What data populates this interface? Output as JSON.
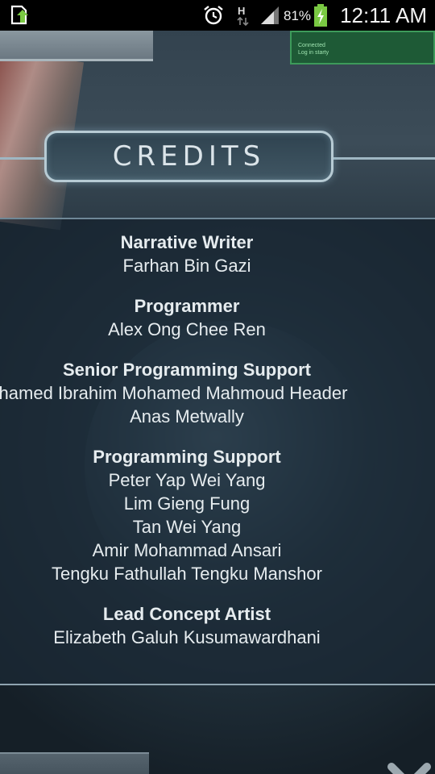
{
  "status_bar": {
    "time": "12:11 AM",
    "battery_percent": "81%",
    "network_type": "H",
    "icons": [
      "upload-notification-icon",
      "alarm-icon",
      "network-h-icon",
      "signal-icon",
      "battery-charging-icon"
    ]
  },
  "background": {
    "top_right_panel_lines": [
      "Connected",
      "Log in starty"
    ]
  },
  "credits": {
    "title": "CREDITS",
    "sections": [
      {
        "role": "Narrative Writer",
        "names": [
          "Farhan Bin Gazi"
        ]
      },
      {
        "role": "Programmer",
        "names": [
          "Alex Ong Chee Ren"
        ]
      },
      {
        "role": "Senior Programming Support",
        "names": [
          "hamed Ibrahim Mohamed Mahmoud Header",
          "Anas Metwally"
        ]
      },
      {
        "role": "Programming Support",
        "names": [
          "Peter Yap Wei Yang",
          "Lim Gieng Fung",
          "Tan Wei Yang",
          "Amir Mohammad Ansari",
          "Tengku Fathullah Tengku Manshor"
        ]
      },
      {
        "role": "Lead Concept Artist",
        "names": [
          "Elizabeth Galuh Kusumawardhani"
        ]
      }
    ]
  },
  "colors": {
    "status_bar_bg": "#000000",
    "text": "#e6ecef",
    "battery_green": "#7ac943",
    "title_border": "#b7cbd4"
  }
}
